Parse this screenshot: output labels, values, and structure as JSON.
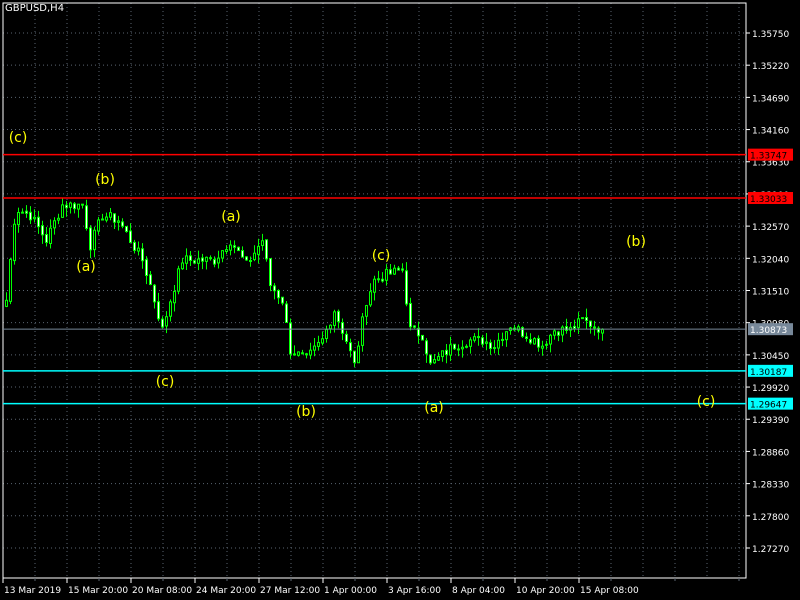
{
  "window": {
    "title": "GBPUSD,H4"
  },
  "colors": {
    "bull": "#00ff00",
    "bear": "#ffffff",
    "grid": "#5a6470",
    "resistance": "#ff0000",
    "support": "#00ffff",
    "current": "#778899",
    "wave_label": "#ffff00"
  },
  "chart_data": {
    "type": "candlestick",
    "symbol": "GBPUSD",
    "timeframe": "H4",
    "ylim": [
      1.27,
      1.3628
    ],
    "y_ticks": [
      "1.35750",
      "1.35220",
      "1.34690",
      "1.34160",
      "1.33630",
      "1.33100",
      "1.32570",
      "1.32040",
      "1.31510",
      "1.30980",
      "1.30450",
      "1.29920",
      "1.29390",
      "1.28860",
      "1.28330",
      "1.27800",
      "1.27270"
    ],
    "x_ticks": [
      "13 Mar 2019",
      "15 Mar 20:00",
      "20 Mar 08:00",
      "24 Mar 20:00",
      "27 Mar 12:00",
      "1 Apr 00:00",
      "3 Apr 16:00",
      "8 Apr 04:00",
      "10 Apr 20:00",
      "15 Apr 08:00"
    ],
    "close_path": [
      [
        0,
        1.3135
      ],
      [
        2,
        1.3267
      ],
      [
        3,
        1.3284
      ],
      [
        6,
        1.3275
      ],
      [
        10,
        1.3234
      ],
      [
        14,
        1.3292
      ],
      [
        19,
        1.3292
      ],
      [
        21,
        1.3226
      ],
      [
        24,
        1.3275
      ],
      [
        28,
        1.3267
      ],
      [
        31,
        1.3234
      ],
      [
        34,
        1.3201
      ],
      [
        36,
        1.316
      ],
      [
        39,
        1.3086
      ],
      [
        41,
        1.3135
      ],
      [
        44,
        1.3201
      ],
      [
        49,
        1.3201
      ],
      [
        52,
        1.3201
      ],
      [
        56,
        1.3234
      ],
      [
        60,
        1.3193
      ],
      [
        64,
        1.3234
      ],
      [
        66,
        1.316
      ],
      [
        69,
        1.3135
      ],
      [
        71,
        1.3053
      ],
      [
        75,
        1.3037
      ],
      [
        79,
        1.3069
      ],
      [
        82,
        1.3119
      ],
      [
        85,
        1.3069
      ],
      [
        87,
        1.3028
      ],
      [
        90,
        1.3135
      ],
      [
        92,
        1.3168
      ],
      [
        95,
        1.3177
      ],
      [
        99,
        1.3185
      ],
      [
        101,
        1.3086
      ],
      [
        104,
        1.3078
      ],
      [
        106,
        1.3028
      ],
      [
        109,
        1.3045
      ],
      [
        112,
        1.3061
      ],
      [
        116,
        1.3069
      ],
      [
        119,
        1.3069
      ],
      [
        122,
        1.3061
      ],
      [
        126,
        1.3094
      ],
      [
        130,
        1.3078
      ],
      [
        134,
        1.3061
      ],
      [
        137,
        1.3086
      ],
      [
        141,
        1.3086
      ],
      [
        144,
        1.3102
      ],
      [
        149,
        1.3087
      ]
    ],
    "levels": [
      {
        "name": "resistance-1",
        "price": 1.33747,
        "label": "1.33747",
        "kind": "resistance"
      },
      {
        "name": "resistance-2",
        "price": 1.33033,
        "label": "1.33033",
        "kind": "resistance"
      },
      {
        "name": "support-1",
        "price": 1.30187,
        "label": "1.30187",
        "kind": "support"
      },
      {
        "name": "support-2",
        "price": 1.29647,
        "label": "1.29647",
        "kind": "support"
      },
      {
        "name": "current-price",
        "price": 1.30873,
        "label": "1.30873",
        "kind": "current"
      }
    ],
    "wave_labels": [
      "(c)",
      "(b)",
      "(a)",
      "(a)",
      "(c)",
      "(b)",
      "(c)",
      "(a)",
      "(b)",
      "(c)"
    ]
  }
}
